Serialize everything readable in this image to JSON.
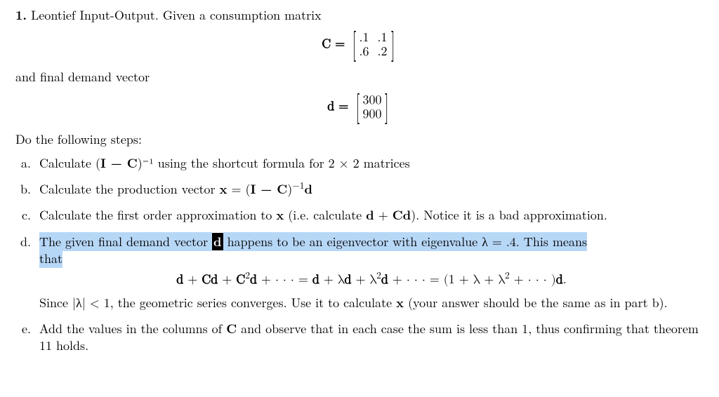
{
  "problem": {
    "number": "1.",
    "title": "Leontief Input-Output. Given a consumption matrix"
  },
  "matrixC": {
    "prefix": "C =",
    "r0c0": ".1",
    "r0c1": ".1",
    "r1c0": ".6",
    "r1c1": ".2"
  },
  "demand_text": "and final demand vector",
  "vectorD": {
    "prefix": "d =",
    "r0": "300",
    "r1": "900"
  },
  "steps_intro": "Do the following steps:",
  "items": {
    "a": {
      "pre": "Calculate (",
      "inv": "I − C",
      "suf": ")⁻¹ using the shortcut formula for 2 × 2 matrices"
    },
    "b": "Calculate the production vector x = (I − C)⁻¹d",
    "c": "Calculate the first order approximation to x (i.e. calculate d + Cd). Notice it is a bad approximation.",
    "d": {
      "sel1": "The given final demand vector ",
      "sel_d": "d",
      "sel2": " happens to be an eigenvector with eigenvalue ",
      "sel_lambda": "λ = .4. This means",
      "sel_that": "that",
      "eq_left": "d + Cd + C²d + · · · = d + λd + λ²d + · · · = (1 + λ + λ² + · · · )d.",
      "after": "Since |λ| < 1, the geometric series converges. Use it to calculate x (your answer should be the same as in part b)."
    },
    "e": "Add the values in the columns of C and observe that in each case the sum is less than 1, thus confirming that theorem 11 holds."
  }
}
